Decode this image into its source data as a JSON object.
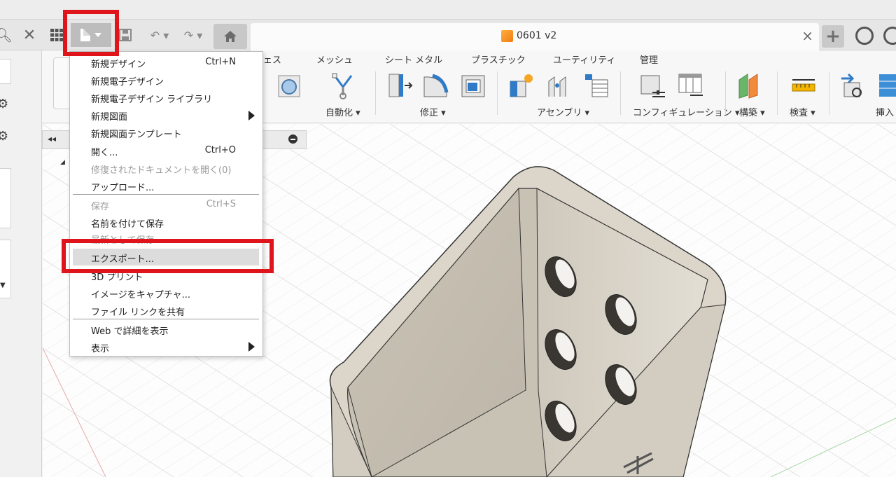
{
  "document_tab": {
    "title": "0601 v2",
    "close": "×"
  },
  "ribbon": {
    "tabs": [
      "ェス",
      "メッシュ",
      "シート メタル",
      "プラスチック",
      "ユーティリティ",
      "管理"
    ],
    "groups": [
      "自動化 ▾",
      "修正 ▾",
      "アセンブリ ▾",
      "コンフィギュレーション ▾",
      "構築 ▾",
      "検査 ▾",
      "挿入"
    ]
  },
  "file_menu": {
    "items": [
      {
        "label": "新規デザイン",
        "shortcut": "Ctrl+N",
        "disabled": false
      },
      {
        "label": "新規電子デザイン",
        "shortcut": "",
        "disabled": false
      },
      {
        "label": "新規電子デザイン ライブラリ",
        "shortcut": "",
        "disabled": false
      },
      {
        "label": "新規図面",
        "shortcut": "",
        "disabled": false,
        "submenu": true
      },
      {
        "label": "新規図面テンプレート",
        "shortcut": "",
        "disabled": false
      },
      {
        "label": "開く...",
        "shortcut": "Ctrl+O",
        "disabled": false
      },
      {
        "label": "修復されたドキュメントを開く(0)",
        "shortcut": "",
        "disabled": true
      },
      {
        "label": "アップロード...",
        "shortcut": "",
        "disabled": false
      },
      {
        "label": "保存",
        "shortcut": "Ctrl+S",
        "disabled": true
      },
      {
        "label": "名前を付けて保存",
        "shortcut": "",
        "disabled": false
      },
      {
        "label": "最新として保存",
        "shortcut": "",
        "disabled": true
      },
      {
        "label": "エクスポート...",
        "shortcut": "",
        "disabled": false,
        "highlighted": true
      },
      {
        "label": "3D プリント",
        "shortcut": "",
        "disabled": false
      },
      {
        "label": "イメージをキャプチャ...",
        "shortcut": "",
        "disabled": false
      },
      {
        "label": "ファイル リンクを共有",
        "shortcut": "",
        "disabled": false
      },
      {
        "label": "Web で詳細を表示",
        "shortcut": "",
        "disabled": false
      },
      {
        "label": "表示",
        "shortcut": "",
        "disabled": false,
        "submenu": true
      }
    ]
  },
  "colors": {
    "highlight_box": "#e0141b",
    "model_body": "#d6d0c4",
    "model_inner": "#ded9ce"
  },
  "icons": [
    "search-icon",
    "close-icon",
    "grid-icon",
    "file-icon",
    "save-icon",
    "undo-icon",
    "redo-icon",
    "home-icon",
    "plus-icon",
    "clock-icon"
  ]
}
